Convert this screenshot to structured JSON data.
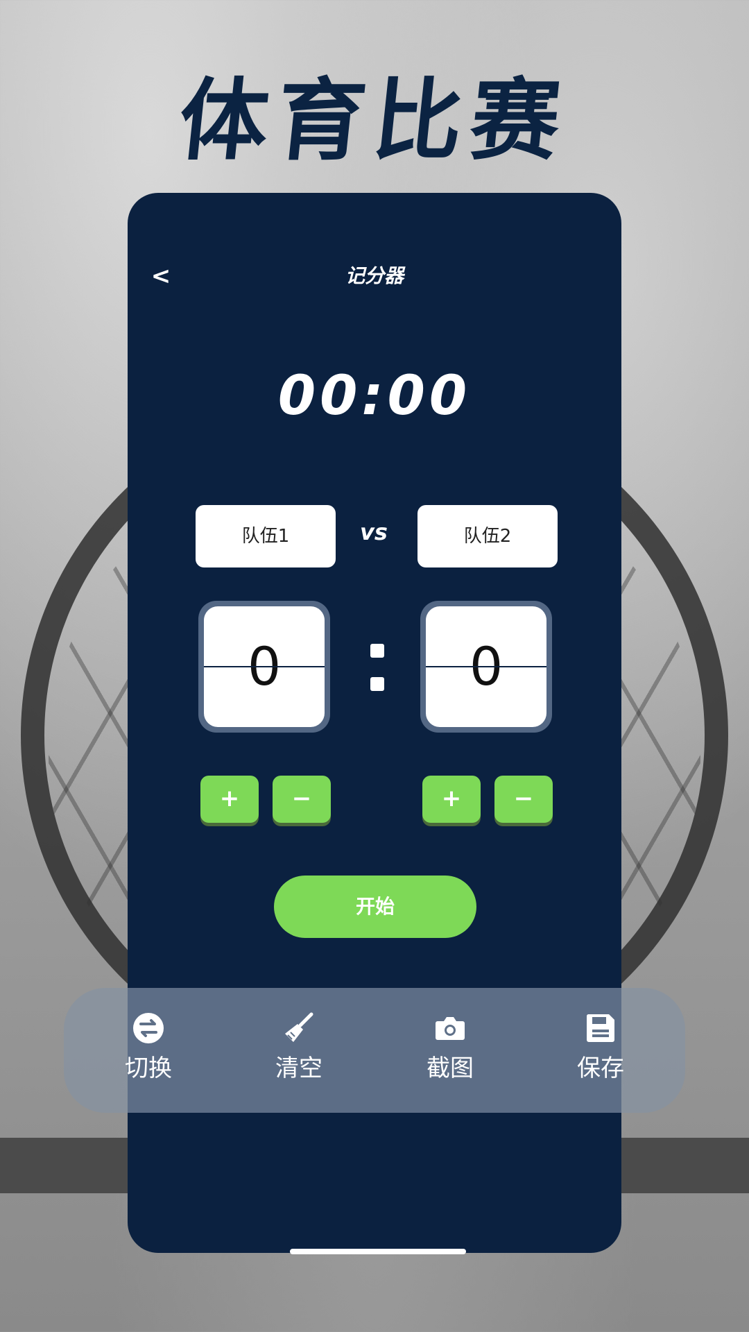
{
  "headline": "体育比赛",
  "nav": {
    "back": "<",
    "title": "记分器"
  },
  "timer": "00:00",
  "teams": {
    "team1": "队伍1",
    "vs": "vs",
    "team2": "队伍2"
  },
  "scores": {
    "team1": "0",
    "team2": "0"
  },
  "buttons": {
    "plus": "+",
    "minus": "−",
    "start": "开始"
  },
  "toolbar": [
    {
      "label": "切换",
      "icon": "switch-icon"
    },
    {
      "label": "清空",
      "icon": "broom-icon"
    },
    {
      "label": "截图",
      "icon": "camera-icon"
    },
    {
      "label": "保存",
      "icon": "save-icon"
    }
  ],
  "colors": {
    "navy": "#0b2140",
    "green": "#7ed957",
    "toolbar": "#5f7088"
  }
}
